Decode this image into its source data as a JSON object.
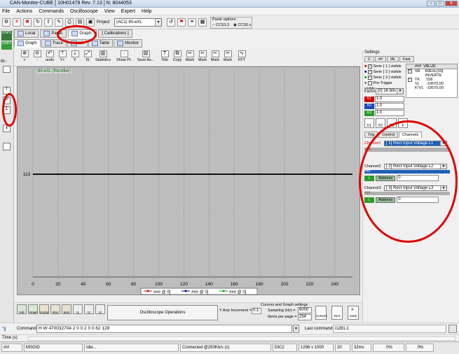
{
  "window": {
    "title": "CAN-Monitor-CUBE [ 10H01479 Rev. 7.13 ] N: 8044053"
  },
  "menu": [
    "File",
    "Actions",
    "Commands",
    "Oscilloscope",
    "View",
    "Expert",
    "Help"
  ],
  "toolbar": {
    "project_label": "Project",
    "project_value": "(AC1) 80-eXL",
    "paste_title": "Paste options :",
    "paste_opt1": "CCS3.3",
    "paste_opt2": "CCS5.x"
  },
  "left_strip": {
    "dsp_label1": "DSP1",
    "dsp_label2": "DSP2",
    "speed": "80--",
    "b_label": "5P"
  },
  "tabs_main": [
    "Local",
    "Parall.",
    "Graph..",
    "[ Calibrations ]"
  ],
  "tabs_sub": [
    "Graph",
    "Trace",
    "Lib",
    "Table",
    "Monitor"
  ],
  "tools": [
    "+",
    "-",
    "undo",
    "Y+",
    "Y-",
    "fit",
    "Statistics",
    "Show Pt.",
    "Save As...",
    "Title",
    "Copy",
    "Mark",
    "Mark",
    "Mark",
    "Mark",
    "FFT"
  ],
  "plot": {
    "channel_label": "80-eXL (Rectifier)",
    "y_value": "113",
    "legend": [
      "### @ 0]",
      "### @ 0]",
      "### @ 0]"
    ]
  },
  "chart_data": {
    "type": "line",
    "x_ticks": [
      0,
      20,
      40,
      60,
      80,
      100,
      120,
      140,
      160,
      180,
      200,
      220,
      240
    ],
    "xlim": [
      0,
      254
    ],
    "series": [
      {
        "name": "### @ 0]",
        "x": [
          0,
          254
        ],
        "y": [
          113,
          113
        ]
      }
    ],
    "y_label_value": "113",
    "grid": true
  },
  "settings": {
    "title": "Settings",
    "tabs_top": [
      "C",
      "##",
      "I/E",
      "Fast"
    ],
    "series_rows": [
      "Serie [ 1 ] visible",
      "Serie [ 2 ] visible",
      "Serie [ 3 ] visible",
      "Pre-Trigger visible"
    ],
    "table_head": [
      "###",
      "VALUE"
    ],
    "table_rows": [
      {
        "k": "SR",
        "v": "80EXL[03] INVERTE"
      },
      {
        "k": "TK",
        "v": "158"
      },
      {
        "k": "VL",
        "v": "-19570.00"
      },
      {
        "k": "K*VL",
        "v": "-19570.00"
      }
    ],
    "factor_label": "Factor",
    "factor_value": "[0] 16 bits",
    "k_rows": [
      {
        "tag": "K1",
        "val": "1.0"
      },
      {
        "tag": "K2",
        "val": "1.0"
      },
      {
        "tag": "K3",
        "val": "1.0"
      }
    ],
    "f_buttons": [
      "F1",
      "F2",
      "F3",
      "F"
    ],
    "ctrl_tabs": [
      "Trig",
      "Control",
      "Channels"
    ],
    "channels": [
      {
        "label": "Channel1",
        "value": "[ 1] Rect Input Voltage L1",
        "addr_label": "Address",
        "addr_value": "0",
        "l_tag": "L"
      },
      {
        "label": "Channel2",
        "value": "[ 2] Rect Input Voltage L2",
        "addr_label": "Address",
        "addr_value": "0",
        "l_tag": "L"
      },
      {
        "label": "Channel3",
        "value": "[ 3] Rect Input Voltage L3",
        "addr_label": "Address",
        "addr_value": "0",
        "l_tag": "L"
      }
    ],
    "ch_hash": "###"
  },
  "bottom": {
    "osc_ops": "Oscilloscope Operations",
    "cursors_title": "Cursors and Graph settings",
    "y_axis_label": "Y Axis Increment =",
    "y_axis_value": "0.1",
    "sampling_label": "Sampling (Hz) =",
    "sampling_value": "6000",
    "items_label": "Items per page =",
    "items_value": "254",
    "small_btns": [
      "Vdc",
      "Vmain",
      "Imotor",
      "Iinvr",
      "Irect",
      "I1",
      "I2",
      "I3"
    ],
    "right_btns": [
      "Cursors",
      "DLS",
      "extra"
    ]
  },
  "command": {
    "label": "Command:",
    "value": "H W 470032704 2 0 0 2 0 0 62 128",
    "last_label": "Last command:",
    "last_value": "i1281.1"
  },
  "time_label": "Time (s)",
  "status": {
    "rate": "#/#",
    "msgid": "MSGID",
    "idle": "Idle...",
    "connected": "Connected @250Kb/s (c)",
    "dic": "DIC2",
    "res": "1296 x 1000",
    "n": "20",
    "ms": "32ms",
    "p1": "0%",
    "p2": "0%"
  }
}
